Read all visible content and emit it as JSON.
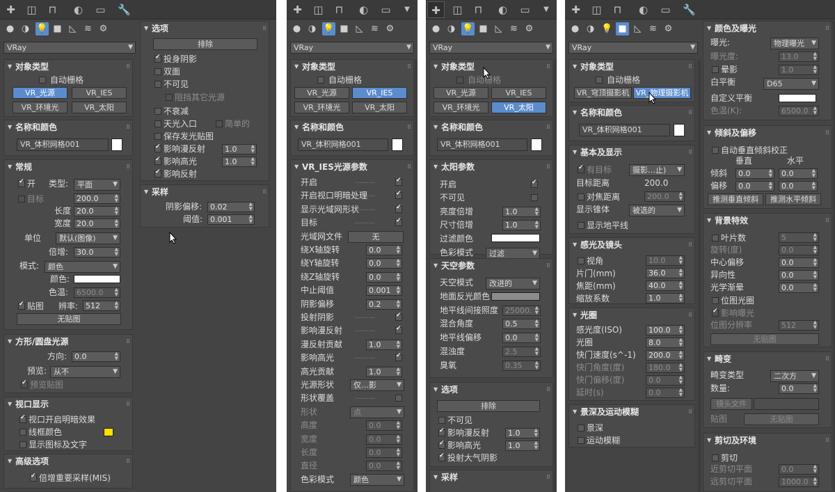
{
  "common": {
    "renderer": "VRay",
    "name_value": "VR_体积网格001"
  },
  "p1": {
    "object_type": {
      "title": "对象类型",
      "autogrid": "自动栅格",
      "b1": "VR_光源",
      "b2": "VR_IES",
      "b3": "VR_环境光",
      "b4": "VR_太阳"
    },
    "name_color": {
      "title": "名称和颜色"
    },
    "general": {
      "title": "常规",
      "on": "开",
      "type_label": "类型:",
      "type_value": "平面",
      "target": "目标",
      "target_value": "200.0",
      "length": "长度",
      "length_value": "20.0",
      "width": "宽度",
      "width_value": "20.0",
      "units": "单位",
      "units_value": "默认(图像)",
      "multiplier": "倍增:",
      "multiplier_value": "30.0",
      "mode": "模式:",
      "mode_value": "颜色",
      "color": "颜色:",
      "temp": "色温:",
      "temp_value": "6500.0",
      "texture": "贴图",
      "resolution": "辨率:",
      "resolution_value": "512",
      "no_map": "无贴图"
    },
    "shape": {
      "title": "方形/圆盘光源",
      "direction": "方向:",
      "direction_value": "0.0",
      "preview": "预览:",
      "preview_value": "从不",
      "preview_map": "预览贴图"
    },
    "viewport": {
      "title": "视口显示",
      "v1": "视口开启明暗效果",
      "v2": "线框颜色",
      "v3": "显示图标及文字",
      "swatch": "#ffe000"
    },
    "advanced": {
      "title": "高级选项",
      "mis": "倍增重要采样(MIS)"
    },
    "options": {
      "title": "选项",
      "exclude": "排除",
      "cast": "投身阴影",
      "double": "双面",
      "invisible": "不可见",
      "occlude": "阻挡其它光源",
      "no_decay": "不衰减",
      "portal": "天光入口",
      "simple": "简单的",
      "store": "保存发光贴图",
      "diffuse": "影响漫反射",
      "diffuse_value": "1.0",
      "spec": "影响高光",
      "spec_value": "1.0",
      "refl": "影响反射"
    },
    "sampling": {
      "title": "采样",
      "bias": "阴影偏移:",
      "bias_value": "0.02",
      "cutoff": "阈值:",
      "cutoff_value": "0.001"
    }
  },
  "p2": {
    "object_type": {
      "title": "对象类型",
      "autogrid": "自动栅格",
      "b1": "VR_光源",
      "b2": "VR_IES",
      "b3": "VR_环境光",
      "b4": "VR_太阳"
    },
    "name_color": {
      "title": "名称和颜色"
    },
    "ies": {
      "title": "VR_IES光源参数",
      "rows": [
        {
          "label": "开启",
          "kind": "cb"
        },
        {
          "label": "开启视口明暗处理",
          "kind": "cb"
        },
        {
          "label": "显示光域网形状",
          "kind": "cb"
        },
        {
          "label": "目标",
          "kind": "cb"
        },
        {
          "label": "光域网文件",
          "kind": "btn",
          "value": "无"
        },
        {
          "label": "绕X轴旋转",
          "kind": "sp",
          "value": "0.0"
        },
        {
          "label": "绕Y轴旋转",
          "kind": "sp",
          "value": "0.0"
        },
        {
          "label": "绕Z轴旋转",
          "kind": "sp",
          "value": "0.0"
        },
        {
          "label": "中止阈值",
          "kind": "sp",
          "value": "0.001"
        },
        {
          "label": "阴影偏移",
          "kind": "sp",
          "value": "0.2"
        },
        {
          "label": "投射阴影",
          "kind": "cb"
        },
        {
          "label": "影响漫反射",
          "kind": "cb"
        },
        {
          "label": "漫反射贡献",
          "kind": "sp",
          "value": "1.0"
        },
        {
          "label": "影响高光",
          "kind": "cb"
        },
        {
          "label": "高光贡献",
          "kind": "sp",
          "value": "1.0"
        },
        {
          "label": "光源形状",
          "kind": "dd",
          "value": "仅…影"
        },
        {
          "label": "形状覆盖",
          "kind": "cboff"
        },
        {
          "label": "形状",
          "kind": "dddis",
          "value": "点"
        },
        {
          "label": "高度",
          "kind": "spdis",
          "value": "0.0"
        },
        {
          "label": "宽度",
          "kind": "spdis",
          "value": "0.0"
        },
        {
          "label": "长度",
          "kind": "spdis",
          "value": "0.0"
        },
        {
          "label": "直径",
          "kind": "spdis",
          "value": "0.0"
        },
        {
          "label": "色彩模式",
          "kind": "dd",
          "value": "颜色"
        }
      ]
    }
  },
  "p3": {
    "object_type": {
      "title": "对象类型",
      "autogrid": "自动栅格",
      "b1": "VR_光源",
      "b2": "VR_IES",
      "b3": "VR_环境光",
      "b4": "VR_太阳"
    },
    "name_color": {
      "title": "名称和颜色"
    },
    "sun": {
      "title": "太阳参数",
      "on": "开启",
      "invisible": "不可见",
      "invisible_value": "",
      "intensity": "亮度倍增",
      "intensity_value": "1.0",
      "size": "尺寸倍增",
      "size_value": "1.0",
      "filter": "过滤颜色",
      "color_mode": "色彩模式",
      "color_mode_value": "过滤"
    },
    "sky": {
      "title": "天空参数",
      "model": "天空模式",
      "model_value": "改进的",
      "ground": "地面反光颜色",
      "horizon": "地平线间接照度",
      "horizon_value": "25000.",
      "blend": "混合角度",
      "blend_value": "0.5",
      "offset": "地平线偏移",
      "offset_value": "0.0",
      "turbidity": "混浊度",
      "turbidity_value": "2.5",
      "ozone": "臭氧",
      "ozone_value": "0.35"
    },
    "options": {
      "title": "选项",
      "exclude": "排除",
      "invisible": "不可见",
      "diffuse": "影响漫反射",
      "diffuse_value": "1.0",
      "spec": "影响高光",
      "spec_value": "1.0",
      "atmos": "投射大气阴影"
    },
    "sampling": {
      "title": "采样"
    }
  },
  "p4": {
    "object_type": {
      "title": "对象类型",
      "autogrid": "自动栅格",
      "b1": "VR_穹顶摄影机",
      "b2": "VR_物理摄影机"
    },
    "name_color": {
      "title": "名称和颜色"
    },
    "basic": {
      "title": "基本及显示",
      "targeted": "有目标",
      "targeted_value": "摄影…止)",
      "target_dist": "目标距离",
      "target_dist_value": "200.0",
      "focus_dist": "对焦距离",
      "focus_dist_value": "200.0",
      "show_cone": "显示锥体",
      "show_cone_value": "被选的",
      "show_horizon": "显示地平线"
    },
    "sensor": {
      "title": "感光及镜头",
      "fov": "视角",
      "fov_value": "10.0",
      "film": "片门(mm)",
      "film_value": "36.0",
      "focal": "焦距(mm)",
      "focal_value": "40.0",
      "zoom": "缩放系数",
      "zoom_value": "1.0"
    },
    "aperture": {
      "title": "光圈",
      "iso": "感光度(ISO)",
      "iso_value": "100.0",
      "fnum": "光圈",
      "fnum_value": "8.0",
      "shutter": "快门速度(s^-1)",
      "shutter_value": "200.0",
      "angle": "快门角度(度)",
      "angle_value": "180.0",
      "offset": "快门偏移(度)",
      "offset_value": "0.0",
      "latency": "延时(s)",
      "latency_value": "0.0"
    },
    "dof": {
      "title": "景深及运动模糊",
      "dof": "景深",
      "motion": "运动模糊"
    },
    "color_exposure": {
      "title": "颜色及曝光",
      "exposure": "曝光:",
      "exposure_value": "物理曝光",
      "ev": "曝光度:",
      "ev_value": "13.0",
      "vignette": "晕影",
      "vignette_value": "1.0",
      "wb": "白平衡",
      "wb_value": "D65",
      "custom_wb": "自定义平衡",
      "temp": "色温(K):",
      "temp_value": "6500.0"
    },
    "tilt": {
      "title": "倾斜及偏移",
      "auto": "自动垂直倾斜校正",
      "vertical": "垂直",
      "horizontal": "水平",
      "tilt": "倾斜",
      "tilt_v": "0.0",
      "tilt_h": "0.0",
      "shift": "偏移",
      "shift_v": "0.0",
      "shift_h": "0.0",
      "guess_v": "推测垂直倾斜",
      "guess_h": "推测水平倾斜"
    },
    "bokeh": {
      "title": "背景特效",
      "blades": "叶片数",
      "blades_value": "5",
      "rotation": "旋转(度)",
      "rotation_value": "0.0",
      "center": "中心偏移",
      "center_value": "0.0",
      "aniso": "异向性",
      "aniso_value": "0.0",
      "bloom": "光学渐晕",
      "bloom_value": "0.0",
      "bitmap": "位图光圈",
      "affect": "影响曝光",
      "res": "位图分辨率",
      "res_value": "512",
      "no_map": "无贴图"
    },
    "distortion": {
      "title": "畸变",
      "type": "畸变类型",
      "type_value": "二次方",
      "amount": "数量:",
      "amount_value": "0.0",
      "lens_file": "镜头文件",
      "map": "贴图",
      "no_map": "无贴图"
    },
    "clipping": {
      "title": "剪切及环境",
      "clip": "剪切",
      "near": "近剪切平面",
      "near_value": "0.0",
      "far": "远剪切平面",
      "far_value": "1000.0"
    }
  }
}
